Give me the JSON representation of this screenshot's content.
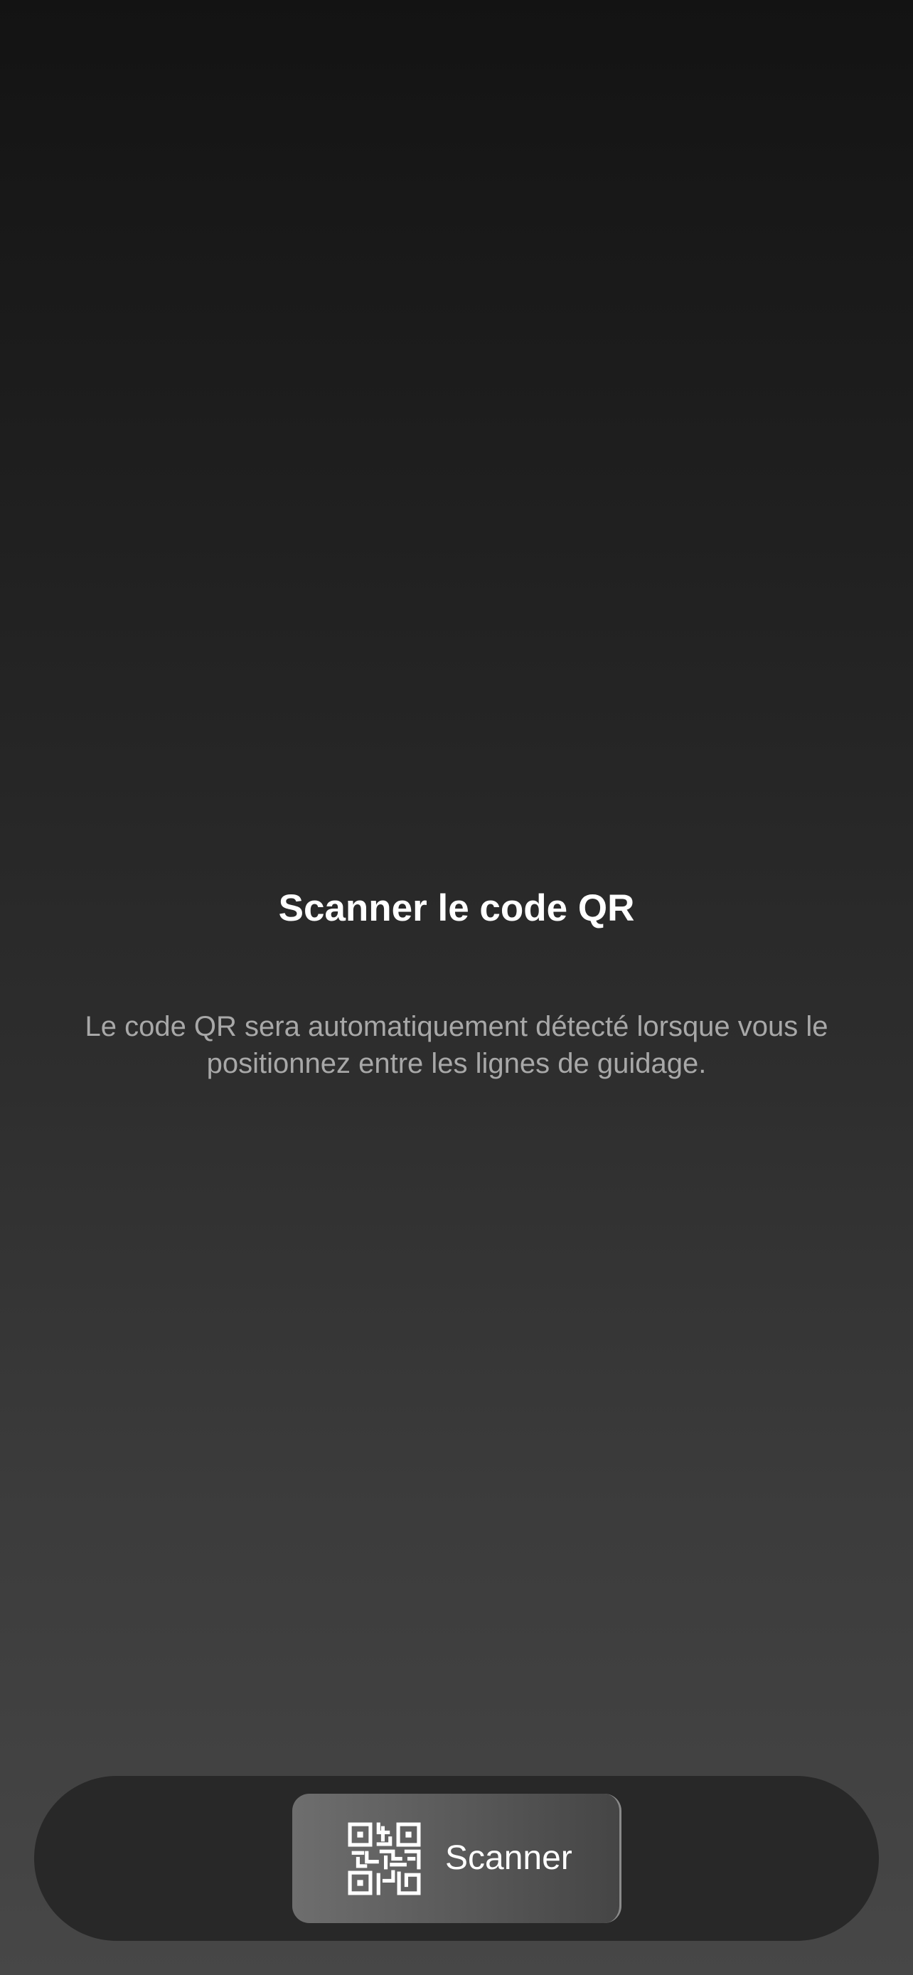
{
  "scan_screen": {
    "title": "Scanner le code QR",
    "description": "Le code QR sera automatiquement détecté lorsque vous le positionnez entre les lignes de guidage."
  },
  "bottom_bar": {
    "scan_button": {
      "label": "Scanner",
      "icon": "qr-code-icon"
    }
  },
  "colors": {
    "background_top": "#131313",
    "background_bottom": "#474747",
    "title": "#ffffff",
    "description": "#a8a8a8",
    "bar": "#282828"
  }
}
